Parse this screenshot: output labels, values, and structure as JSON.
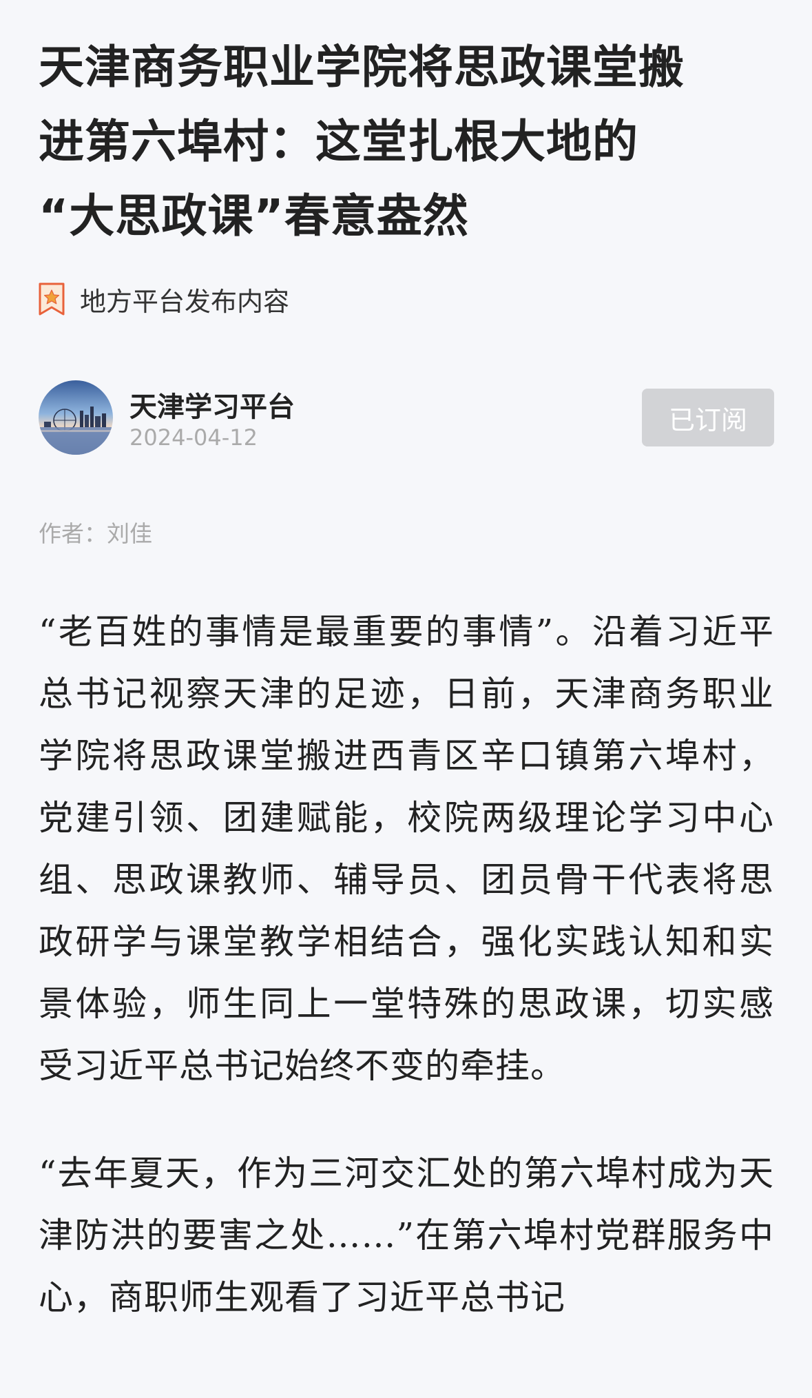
{
  "article": {
    "title_lines": [
      "天津商务职业学院将思政课堂搬",
      "进第六埠村：这堂扎根大地的",
      "“大思政课”春意盎然"
    ],
    "source_label": "地方平台发布内容",
    "account": {
      "name": "天津学习平台",
      "date": "2024-04-12",
      "subscribe_label": "已订阅"
    },
    "byline": "作者：刘佳",
    "paragraphs": [
      "“老百姓的事情是最重要的事情”。沿着习近平总书记视察天津的足迹，日前，天津商务职业学院将思政课堂搬进西青区辛口镇第六埠村，党建引领、团建赋能，校院两级理论学习中心组、思政课教师、辅导员、团员骨干代表将思政研学与课堂教学相结合，强化实践认知和实景体验，师生同上一堂特殊的思政课，切实感受习近平总书记始终不变的牵挂。",
      "“去年夏天，作为三河交汇处的第六埠村成为天津防洪的要害之处……”在第六埠村党群服务中心，商职师生观看了习近平总书记"
    ]
  },
  "icons": {
    "source": "bookmark-star-icon",
    "avatar": "city-skyline-avatar"
  },
  "colors": {
    "background": "#f6f7fa",
    "title": "#222222",
    "muted": "#aaaaaa",
    "subscribe_bg": "#d2d3d6",
    "source_icon": "#e8613a"
  }
}
